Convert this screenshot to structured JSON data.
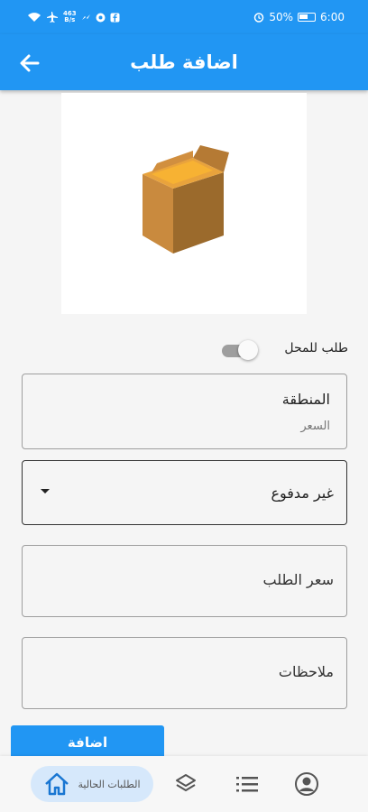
{
  "status_bar": {
    "net_speed_value": "463",
    "net_speed_unit": "B/s",
    "battery": "50%",
    "time": "6:00"
  },
  "app_bar": {
    "title": "اضافة طلب",
    "back_icon": "arrow-back-icon"
  },
  "image": {
    "icon": "cardboard-box-icon"
  },
  "toggle": {
    "label": "طلب للمحل",
    "state": "off"
  },
  "region_field": {
    "label": "المنطقة",
    "hint": "السعر"
  },
  "payment_select": {
    "value": "غير مدفوع"
  },
  "price_field": {
    "placeholder": "سعر الطلب"
  },
  "notes_field": {
    "placeholder": "ملاحظات"
  },
  "submit_button": {
    "label": "اضافة"
  },
  "bottom_nav": {
    "active_label": "الطلبات الحالية",
    "items": [
      "home-icon",
      "layers-icon",
      "list-icon",
      "account-icon"
    ]
  },
  "colors": {
    "primary": "#2196f3",
    "active_nav_bg": "#d6e8fb"
  }
}
